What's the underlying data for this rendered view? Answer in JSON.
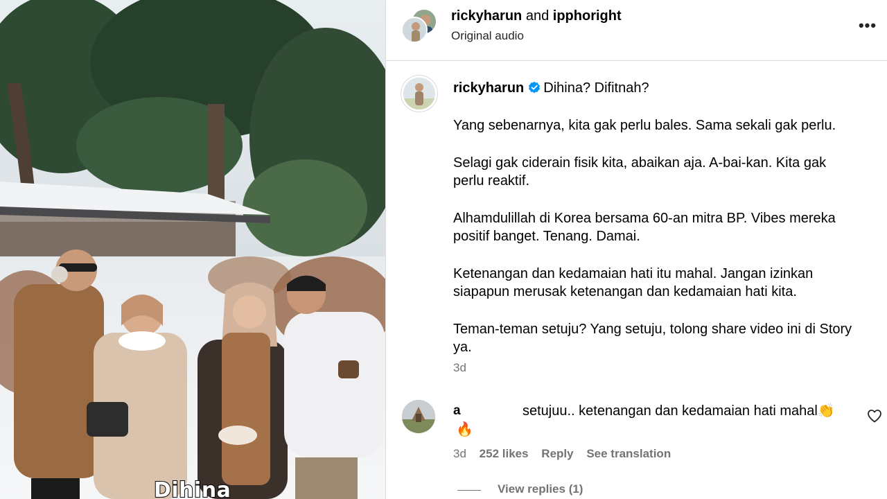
{
  "media": {
    "caption_overlay": "Dihina",
    "image_description_icon": "photo-scene"
  },
  "header": {
    "user1": "rickyharun",
    "joiner": "and",
    "user2": "ipphoright",
    "audio": "Original audio",
    "more_icon": "more-options-icon",
    "more_label": "•••"
  },
  "post": {
    "username": "rickyharun",
    "verified_icon": "verified-badge-icon",
    "first_line": "Dihina? Difitnah?",
    "paragraphs": [
      "Yang sebenarnya, kita gak perlu bales. Sama sekali gak perlu.",
      "Selagi gak ciderain fisik kita, abaikan aja. A-bai-kan. Kita gak perlu reaktif.",
      "Alhamdulillah di Korea bersama 60-an mitra BP. Vibes mereka positif banget. Tenang. Damai.",
      "Ketenangan dan kedamaian hati itu mahal. Jangan izinkan siapapun merusak ketenangan dan kedamaian hati kita.",
      "Teman-teman setuju? Yang setuju, tolong share video ini di Story ya."
    ],
    "time": "3d"
  },
  "comment": {
    "username": "a",
    "text": "setujuu.. ketenangan dan kedamaian hati mahal",
    "clap_emoji": "👏",
    "fire_emoji": "🔥",
    "time": "3d",
    "likes": "252 likes",
    "reply": "Reply",
    "see_translation": "See translation",
    "view_replies": "View replies (1)"
  },
  "colors": {
    "verified": "#0095f6",
    "secondary_text": "#737373",
    "divider": "#dbdbdb"
  }
}
